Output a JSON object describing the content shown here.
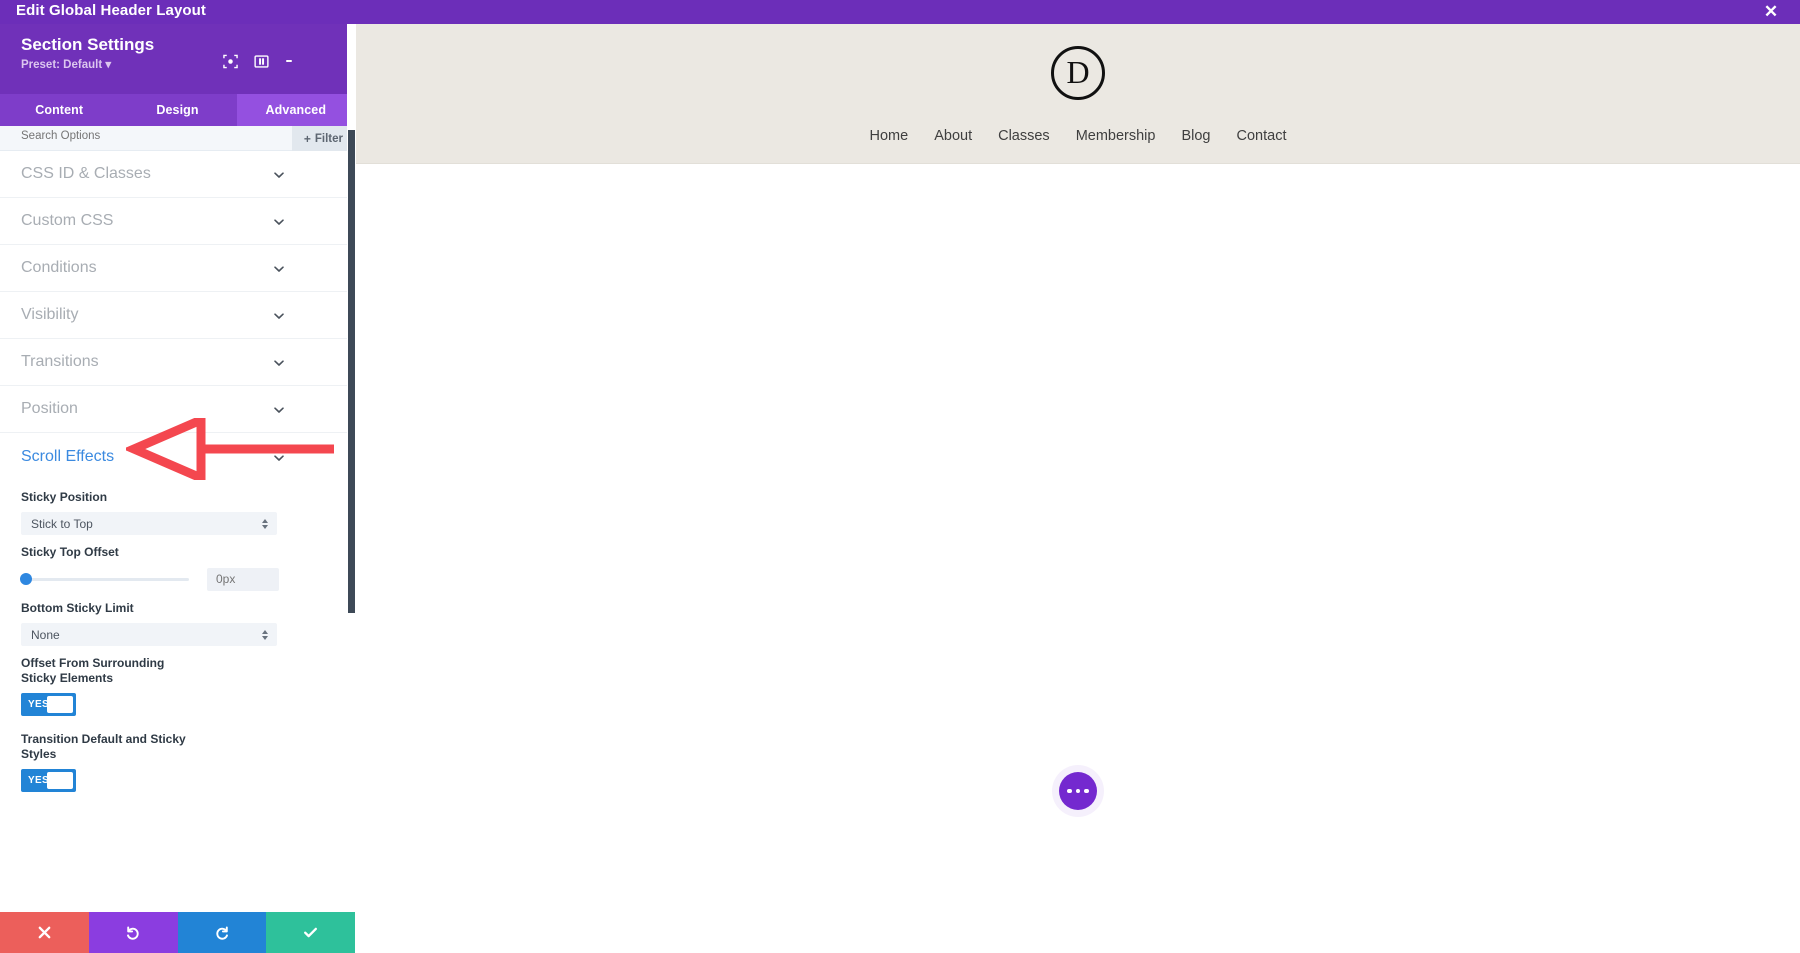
{
  "topbar": {
    "title": "Edit Global Header Layout",
    "close_label": "✕"
  },
  "panel": {
    "title": "Section Settings",
    "preset": "Preset: Default ▾",
    "header_icons": [
      {
        "name": "focus-icon",
        "label": ""
      },
      {
        "name": "split-view-icon",
        "label": ""
      },
      {
        "name": "kebab-menu-icon",
        "label": ""
      }
    ],
    "tabs": [
      {
        "label": "Content",
        "active": false
      },
      {
        "label": "Design",
        "active": false
      },
      {
        "label": "Advanced",
        "active": true
      }
    ],
    "search": {
      "placeholder": "Search Options",
      "value": ""
    },
    "filter": {
      "plus": "+",
      "label": "Filter"
    },
    "sections": [
      {
        "label": "CSS ID & Classes"
      },
      {
        "label": "Custom CSS"
      },
      {
        "label": "Conditions"
      },
      {
        "label": "Visibility"
      },
      {
        "label": "Transitions"
      },
      {
        "label": "Position"
      }
    ],
    "open_section": {
      "label": "Scroll Effects",
      "color": "#3b8ae0",
      "fields": {
        "sticky_position": {
          "label": "Sticky Position",
          "value": "Stick to Top"
        },
        "sticky_top_offset": {
          "label": "Sticky Top Offset",
          "value": "0px",
          "slider_percent": 0
        },
        "bottom_sticky_limit": {
          "label": "Bottom Sticky Limit",
          "value": "None"
        },
        "offset_surrounding": {
          "label": "Offset From Surrounding Sticky Elements",
          "toggle": "YES"
        },
        "transition_styles": {
          "label": "Transition Default and Sticky Styles",
          "toggle": "YES"
        }
      }
    },
    "actions": [
      {
        "name": "cancel-button",
        "glyph": "✖",
        "color": "#ec5f5b"
      },
      {
        "name": "undo-button",
        "glyph": "↺",
        "color": "#8b3de0"
      },
      {
        "name": "redo-button",
        "glyph": "↻",
        "color": "#2284d6"
      },
      {
        "name": "save-button",
        "glyph": "✔",
        "color": "#2ec19b"
      }
    ]
  },
  "preview": {
    "logo_letter": "D",
    "nav": [
      {
        "label": "Home"
      },
      {
        "label": "About"
      },
      {
        "label": "Classes"
      },
      {
        "label": "Membership"
      },
      {
        "label": "Blog"
      },
      {
        "label": "Contact"
      }
    ],
    "fab_label": "•••"
  },
  "annotation": {
    "arrow_color": "#f4474f",
    "points_to": "Scroll Effects"
  }
}
